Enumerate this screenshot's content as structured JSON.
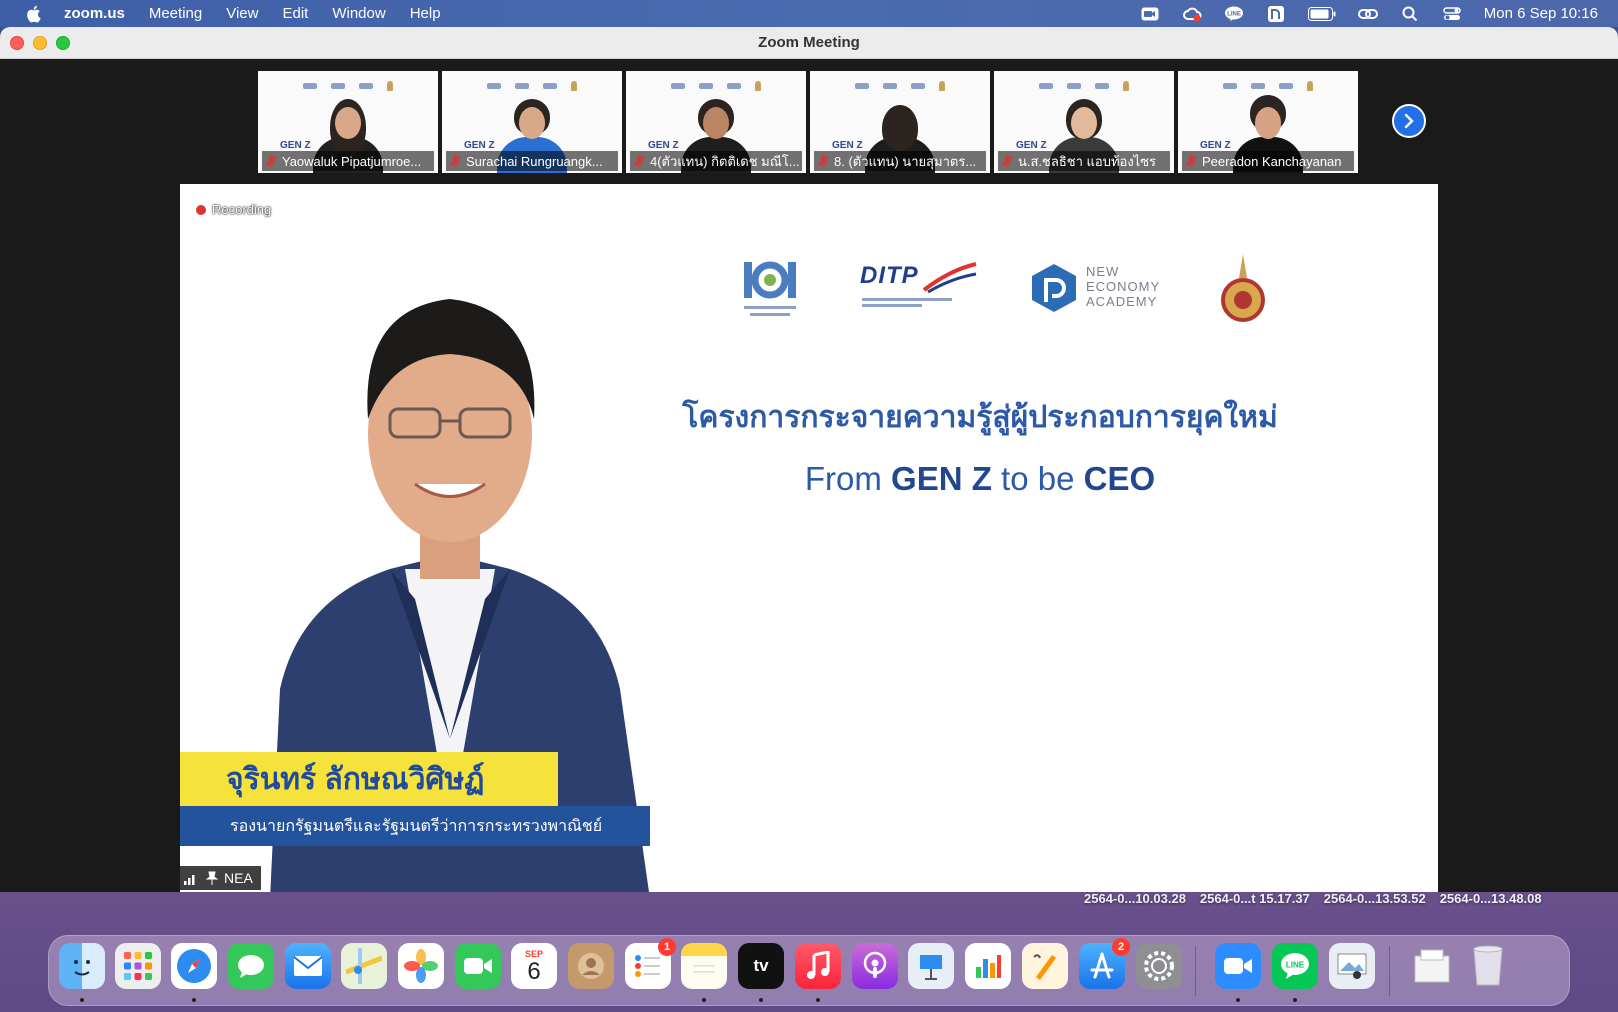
{
  "menubar": {
    "app_name": "zoom.us",
    "items": [
      "Meeting",
      "View",
      "Edit",
      "Window",
      "Help"
    ],
    "clock": "Mon 6 Sep  10:16",
    "tray_icons": [
      "zoom-video-icon",
      "creative-cloud-icon",
      "line-tray-icon",
      "n-app-icon",
      "battery-icon",
      "link-icon",
      "spotlight-search-icon",
      "control-center-icon"
    ]
  },
  "window": {
    "title": "Zoom Meeting"
  },
  "participants": [
    {
      "name": "Yaowaluk Pipatjumroe..."
    },
    {
      "name": "Surachai Rungruangk..."
    },
    {
      "name": "4(ตัวแทน) กิตติเดช มณีโ..."
    },
    {
      "name": "8. (ตัวแทน) นายสุมาตร..."
    },
    {
      "name": "น.ส.ชลธิชา แอบท้องไซร"
    },
    {
      "name": "Peeradon Kanchayanan"
    }
  ],
  "tile_banner": {
    "genz": "GEN Z"
  },
  "stage": {
    "recording": "Recording",
    "logos": {
      "ditp": "DITP",
      "nea": [
        "NEW",
        "ECONOMY",
        "ACADEMY"
      ]
    },
    "thai_title": "โครงการกระจายความรู้สู่ผู้ประกอบการยุคใหม่",
    "eng_title_parts": [
      "From ",
      "GEN Z",
      " to be ",
      "CEO"
    ],
    "speaker_name": "จุรินทร์ ลักษณวิศิษฏ์",
    "speaker_role": "รองนายกรัฐมนตรีและรัฐมนตรีว่าการกระทรวงพาณิชย์",
    "presenter_label": "NEA"
  },
  "desktop_files": [
    "2564-0...10.03.28",
    "2564-0...t 15.17.37",
    "2564-0...13.53.52",
    "2564-0...13.48.08"
  ],
  "dock": {
    "calendar_month": "SEP",
    "calendar_day": "6",
    "reminders_badge": "1",
    "appstore_badge": "2",
    "tv_label": "tv"
  },
  "colors": {
    "accent_blue": "#2d5aa7",
    "name_plate_yellow": "#f5e23a",
    "role_plate_blue": "#24539e",
    "recording_red": "#e0322f"
  }
}
